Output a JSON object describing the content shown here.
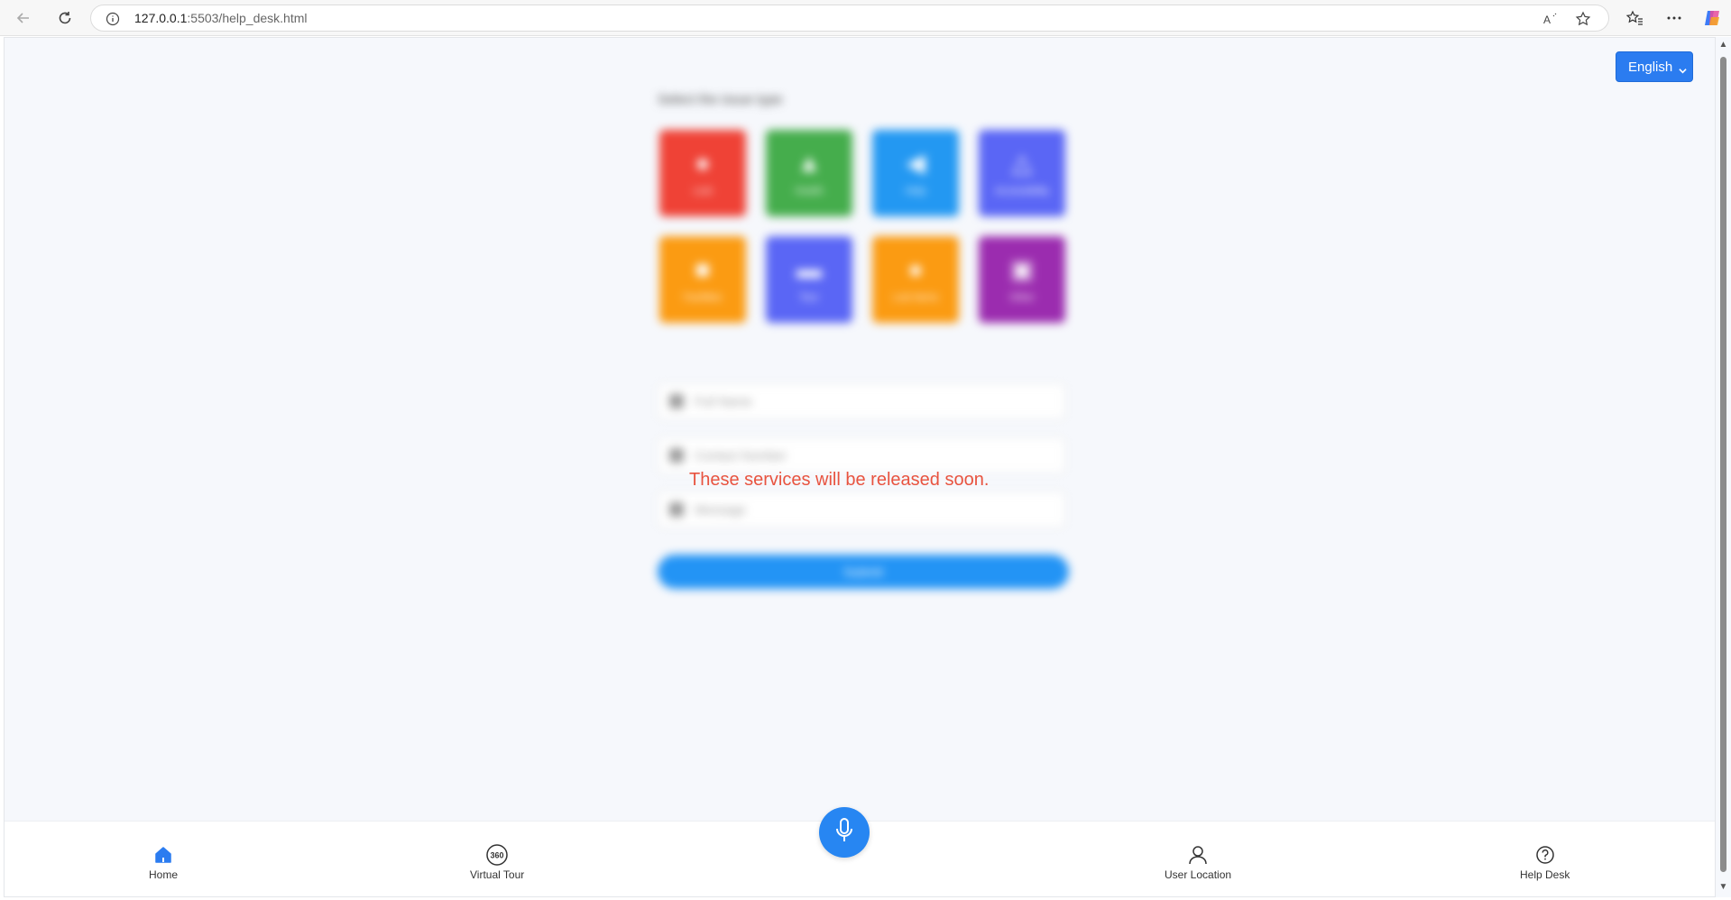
{
  "browser": {
    "url_host": "127.0.0.1",
    "url_rest": ":5503/help_desk.html"
  },
  "page": {
    "language": "English",
    "instruction": "Select the issue type",
    "tiles": [
      {
        "label": "Lost",
        "color": "#ef4236"
      },
      {
        "label": "Health",
        "color": "#45ad4c"
      },
      {
        "label": "Help",
        "color": "#2398f2"
      },
      {
        "label": "Accessibility",
        "color": "#5a66f5"
      },
      {
        "label": "Facilities",
        "color": "#fb9b12"
      },
      {
        "label": "Tour",
        "color": "#5a66f5"
      },
      {
        "label": "Lost Items",
        "color": "#fb9b12"
      },
      {
        "label": "Other",
        "color": "#9b2caf"
      }
    ],
    "fields": [
      "Full Name",
      "Contact Number",
      "Message"
    ],
    "submit_label": "Submit",
    "notice": "These services will be released soon."
  },
  "bottom_nav": {
    "items": [
      {
        "label": "Home",
        "icon": "home-icon"
      },
      {
        "label": "Virtual Tour",
        "icon": "360-icon"
      },
      {
        "label": "User Location",
        "icon": "user-icon"
      },
      {
        "label": "Help Desk",
        "icon": "question-icon"
      }
    ],
    "tour_icon_text": "360",
    "mic_icon": "microphone-icon"
  },
  "colors": {
    "accent": "#2b7cf0",
    "notice": "#e8533f"
  }
}
